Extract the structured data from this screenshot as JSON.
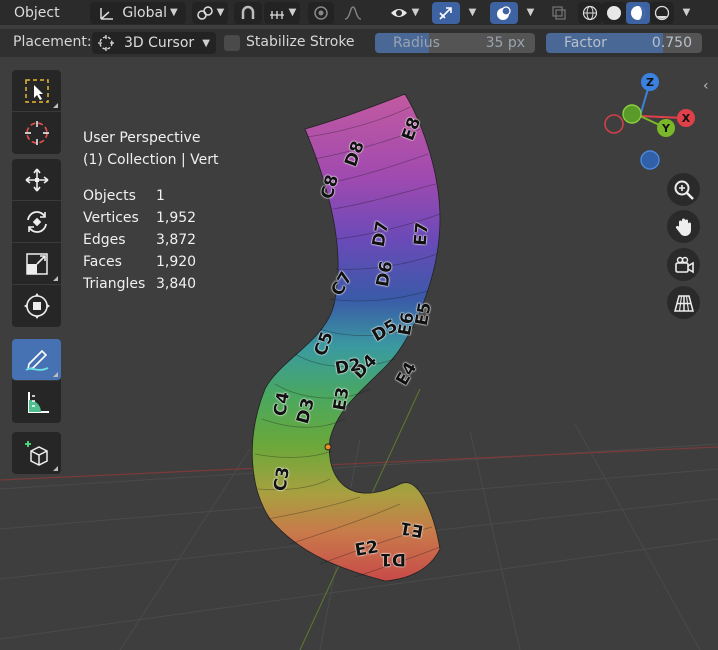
{
  "header": {
    "mode_label": "Object",
    "orientation_label": "Global"
  },
  "tool_settings": {
    "placement_label": "Placement:",
    "placement_value": "3D Cursor",
    "stabilize_label": "Stabilize Stroke",
    "stabilize_checked": false,
    "radius_label": "Radius",
    "radius_value": "35 px",
    "factor_label": "Factor",
    "factor_value": "0.750"
  },
  "viewport": {
    "view_name": "User Perspective",
    "context_line": "(1) Collection | Vert",
    "stats": [
      {
        "label": "Objects",
        "value": "1"
      },
      {
        "label": "Vertices",
        "value": "1,952"
      },
      {
        "label": "Edges",
        "value": "3,872"
      },
      {
        "label": "Faces",
        "value": "1,920"
      },
      {
        "label": "Triangles",
        "value": "3,840"
      }
    ]
  },
  "gizmo": {
    "z": "Z",
    "x": "X",
    "y": "Y",
    "colors": {
      "x": "#e0404a",
      "y": "#7ab82a",
      "z": "#3b82e0"
    }
  },
  "tools": [
    {
      "name": "select-box-tool",
      "icon": "select-box-icon",
      "active": false
    },
    {
      "name": "cursor-tool",
      "icon": "cursor-icon",
      "active": false
    },
    {
      "name": "move-tool",
      "icon": "move-icon",
      "active": false
    },
    {
      "name": "rotate-tool",
      "icon": "rotate-icon",
      "active": false
    },
    {
      "name": "scale-tool",
      "icon": "scale-icon",
      "active": false
    },
    {
      "name": "transform-tool",
      "icon": "transform-icon",
      "active": false
    },
    {
      "name": "annotate-tool",
      "icon": "annotate-icon",
      "active": true
    },
    {
      "name": "measure-tool",
      "icon": "measure-icon",
      "active": false
    },
    {
      "name": "add-cube-tool",
      "icon": "add-cube-icon",
      "active": false
    }
  ],
  "mesh_labels": [
    "D8",
    "E8",
    "C8",
    "D7",
    "E7",
    "C7",
    "D6",
    "E6",
    "D5",
    "E5",
    "C5",
    "D4",
    "E4",
    "C4",
    "D3",
    "E3",
    "C3",
    "D2",
    "E2",
    "D1",
    "E1"
  ],
  "colors": {
    "accent": "#4672b4",
    "header_bg": "#2b2b2b",
    "viewport_bg": "#3e3e3e"
  }
}
